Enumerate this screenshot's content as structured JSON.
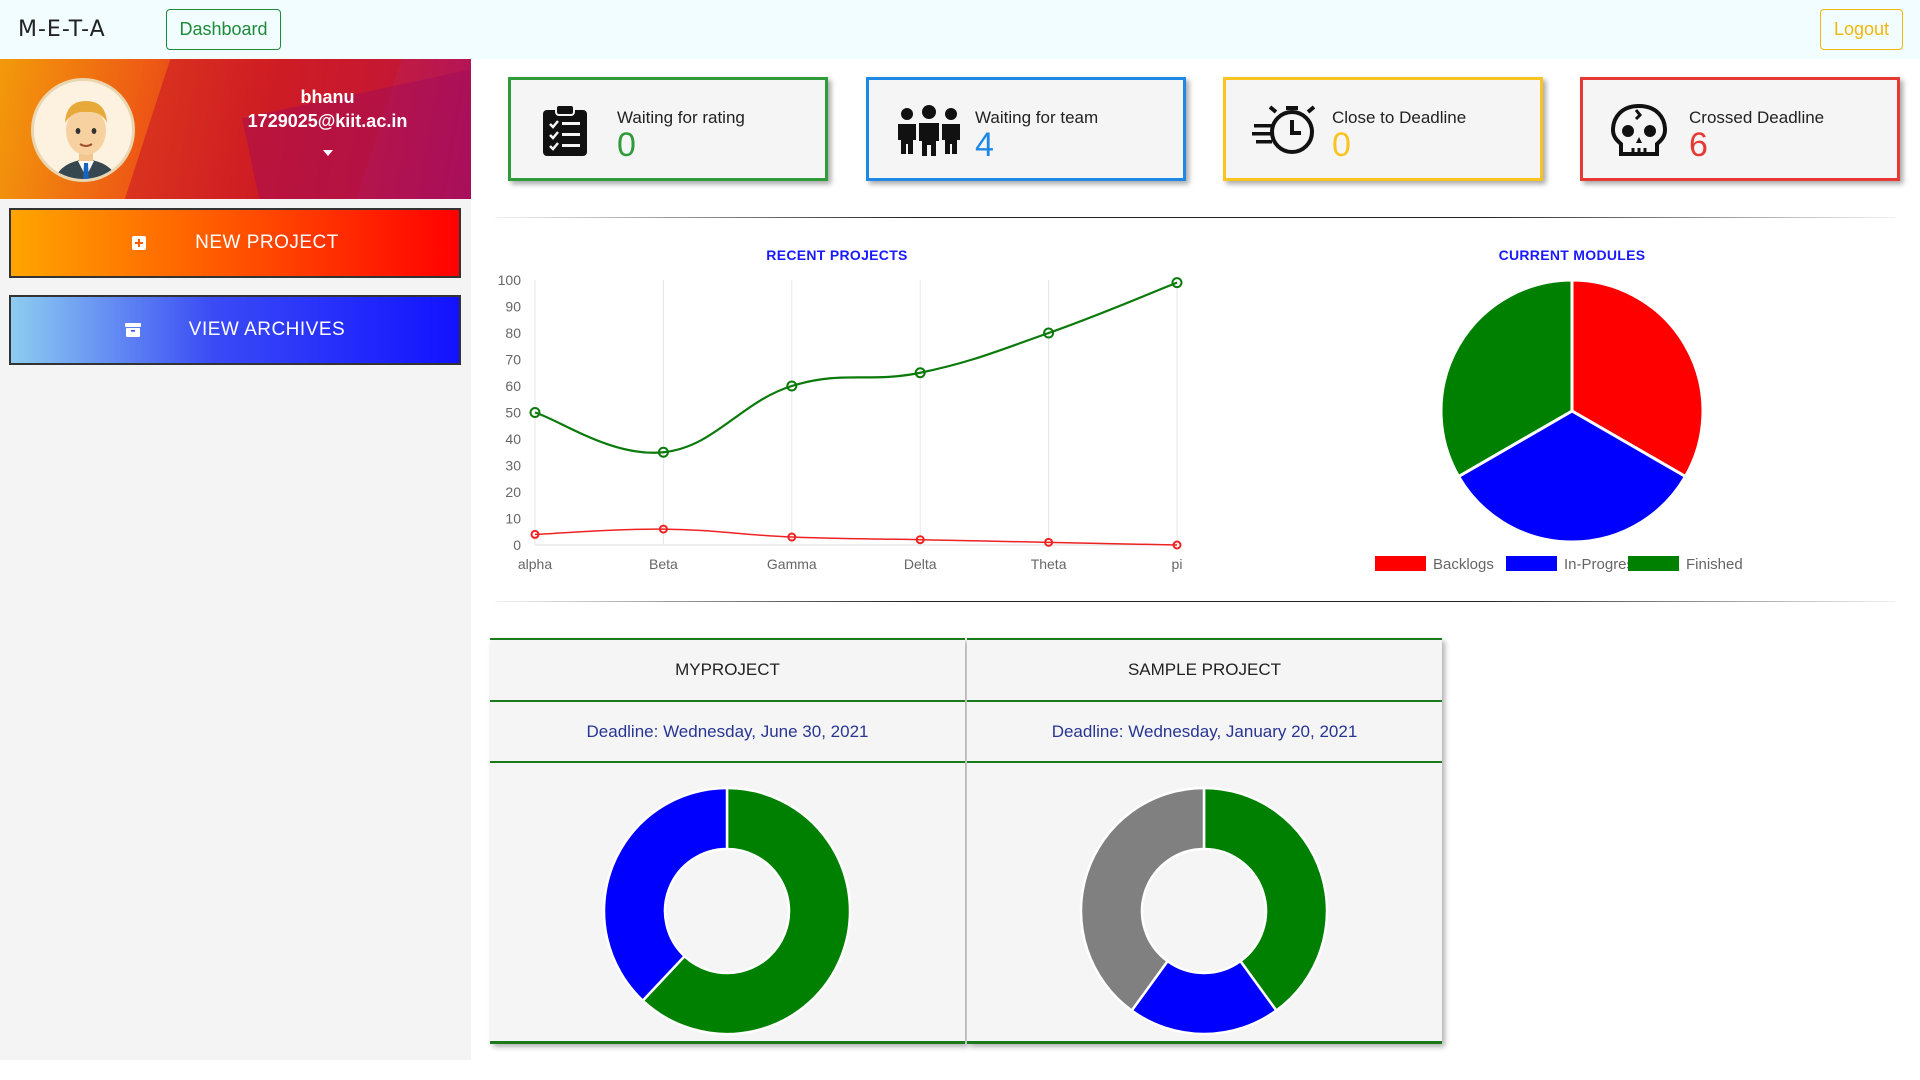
{
  "header": {
    "brand": "M-E-T-A",
    "dashboard_label": "Dashboard",
    "logout_label": "Logout"
  },
  "user": {
    "name": "bhanu",
    "email": "1729025@kiit.ac.in"
  },
  "sidebar": {
    "new_project_label": "NEW PROJECT",
    "view_archives_label": "VIEW ARCHIVES"
  },
  "stats": [
    {
      "label": "Waiting for rating",
      "value": "0",
      "color": "#2e9c3a",
      "icon": "clipboard-checklist-icon"
    },
    {
      "label": "Waiting for team",
      "value": "4",
      "color": "#1e88e5",
      "icon": "team-icon"
    },
    {
      "label": "Close to Deadline",
      "value": "0",
      "color": "#f9c320",
      "icon": "fast-timer-icon"
    },
    {
      "label": "Crossed Deadline",
      "value": "6",
      "color": "#e53935",
      "icon": "skull-icon"
    }
  ],
  "chart_data": [
    {
      "type": "line",
      "title": "RECENT PROJECTS",
      "x": [
        "alpha",
        "Beta",
        "Gamma",
        "Delta",
        "Theta",
        "pi"
      ],
      "ylim": [
        0,
        100
      ],
      "yticks": [
        0,
        10,
        20,
        30,
        40,
        50,
        60,
        70,
        80,
        90,
        100
      ],
      "grid": "vertical",
      "series": [
        {
          "values": [
            50,
            35,
            60,
            65,
            80,
            99
          ],
          "color": "#0a7a0a"
        },
        {
          "values": [
            4,
            6,
            3,
            2,
            1,
            0
          ],
          "color": "#ee2222"
        }
      ]
    },
    {
      "type": "pie",
      "title": "CURRENT MODULES",
      "legend_position": "bottom",
      "slices": [
        {
          "label": "Backlogs",
          "value": 1,
          "color": "#ff0000"
        },
        {
          "label": "In-Progress",
          "value": 1,
          "color": "#0000ff"
        },
        {
          "label": "Finished",
          "value": 1,
          "color": "#008000"
        }
      ]
    },
    {
      "type": "doughnut",
      "title": "MYPROJECT",
      "slices": [
        {
          "value": 62,
          "color": "#008000"
        },
        {
          "value": 38,
          "color": "#0000ff"
        }
      ]
    },
    {
      "type": "doughnut",
      "title": "SAMPLE PROJECT",
      "slices": [
        {
          "value": 40,
          "color": "#008000"
        },
        {
          "value": 20,
          "color": "#0000ff"
        },
        {
          "value": 40,
          "color": "#808080"
        }
      ]
    }
  ],
  "projects": [
    {
      "title": "MYPROJECT",
      "deadline": "Deadline: Wednesday, June 30, 2021"
    },
    {
      "title": "SAMPLE PROJECT",
      "deadline": "Deadline: Wednesday, January 20, 2021"
    }
  ]
}
